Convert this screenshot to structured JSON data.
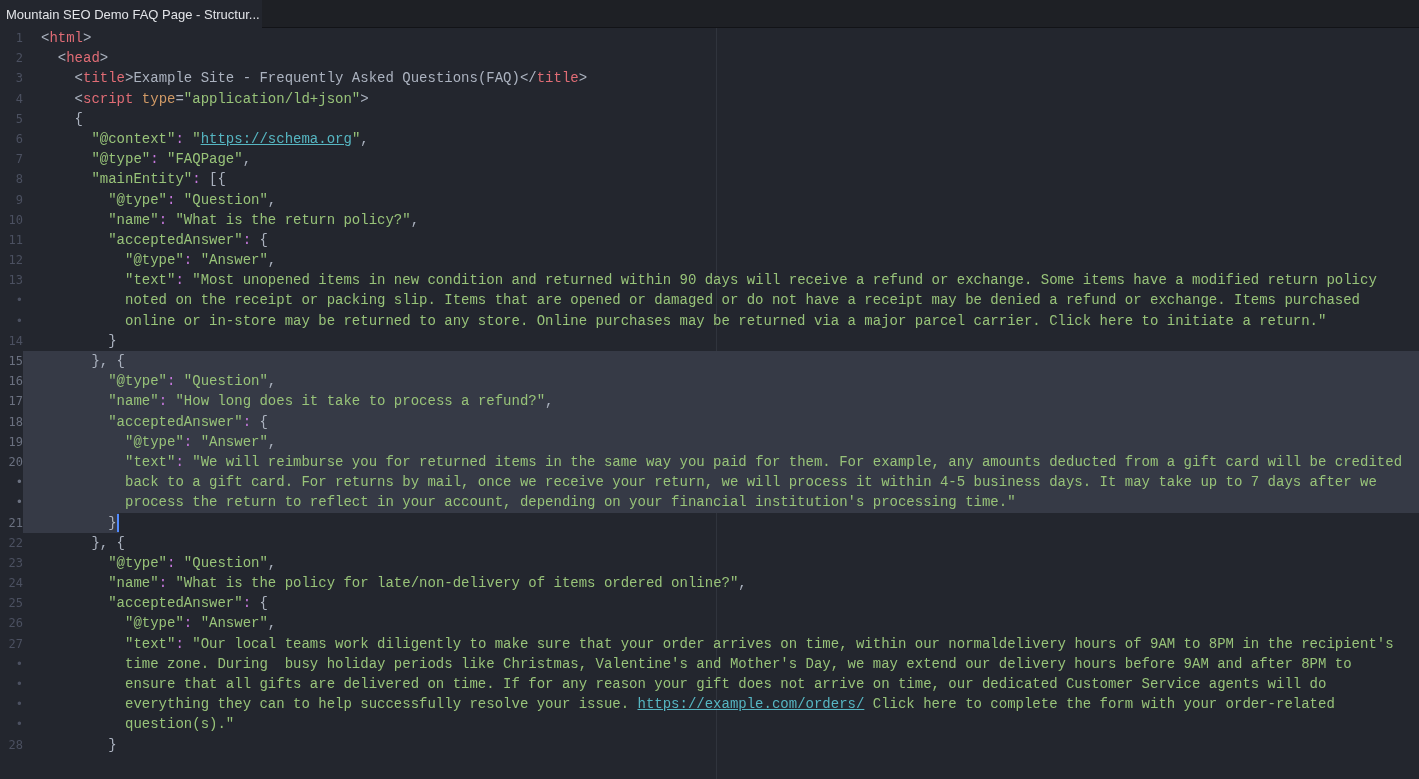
{
  "tab": {
    "title": "Mountain SEO Demo FAQ Page - Structur...",
    "selected": true
  },
  "lines": [
    {
      "gutter": "1",
      "selected": false,
      "cursor": false,
      "tokens": [
        {
          "kind": "punct",
          "text": "<"
        },
        {
          "kind": "tag",
          "text": "html"
        },
        {
          "kind": "punct",
          "text": ">"
        }
      ]
    },
    {
      "gutter": "2",
      "selected": false,
      "cursor": false,
      "tokens": [
        {
          "kind": "punct",
          "text": "  <"
        },
        {
          "kind": "tag",
          "text": "head"
        },
        {
          "kind": "punct",
          "text": ">"
        }
      ]
    },
    {
      "gutter": "3",
      "selected": false,
      "cursor": false,
      "tokens": [
        {
          "kind": "punct",
          "text": "    <"
        },
        {
          "kind": "tag",
          "text": "title"
        },
        {
          "kind": "punct",
          "text": ">"
        },
        {
          "kind": "plain",
          "text": "Example Site - Frequently Asked Questions(FAQ)"
        },
        {
          "kind": "punct",
          "text": "</"
        },
        {
          "kind": "tag",
          "text": "title"
        },
        {
          "kind": "punct",
          "text": ">"
        }
      ]
    },
    {
      "gutter": "4",
      "selected": false,
      "cursor": false,
      "tokens": [
        {
          "kind": "punct",
          "text": "    <"
        },
        {
          "kind": "tag",
          "text": "script "
        },
        {
          "kind": "attr",
          "text": "type"
        },
        {
          "kind": "punct",
          "text": "="
        },
        {
          "kind": "string",
          "text": "\"application/ld+json\""
        },
        {
          "kind": "punct",
          "text": ">"
        }
      ]
    },
    {
      "gutter": "5",
      "selected": false,
      "cursor": false,
      "tokens": [
        {
          "kind": "punct",
          "text": "    {"
        }
      ]
    },
    {
      "gutter": "6",
      "selected": false,
      "cursor": false,
      "tokens": [
        {
          "kind": "string",
          "text": "      \"@context\""
        },
        {
          "kind": "colon",
          "text": ": "
        },
        {
          "kind": "string",
          "text": "\""
        },
        {
          "kind": "link",
          "text": "https://schema.org"
        },
        {
          "kind": "string",
          "text": "\""
        },
        {
          "kind": "punct",
          "text": ","
        }
      ]
    },
    {
      "gutter": "7",
      "selected": false,
      "cursor": false,
      "tokens": [
        {
          "kind": "string",
          "text": "      \"@type\""
        },
        {
          "kind": "colon",
          "text": ": "
        },
        {
          "kind": "string",
          "text": "\"FAQPage\""
        },
        {
          "kind": "punct",
          "text": ","
        }
      ]
    },
    {
      "gutter": "8",
      "selected": false,
      "cursor": false,
      "tokens": [
        {
          "kind": "string",
          "text": "      \"mainEntity\""
        },
        {
          "kind": "colon",
          "text": ": "
        },
        {
          "kind": "punct",
          "text": "[{"
        }
      ]
    },
    {
      "gutter": "9",
      "selected": false,
      "cursor": false,
      "tokens": [
        {
          "kind": "string",
          "text": "        \"@type\""
        },
        {
          "kind": "colon",
          "text": ": "
        },
        {
          "kind": "string",
          "text": "\"Question\""
        },
        {
          "kind": "punct",
          "text": ","
        }
      ]
    },
    {
      "gutter": "10",
      "selected": false,
      "cursor": false,
      "tokens": [
        {
          "kind": "string",
          "text": "        \"name\""
        },
        {
          "kind": "colon",
          "text": ": "
        },
        {
          "kind": "string",
          "text": "\"What is the return policy?\""
        },
        {
          "kind": "punct",
          "text": ","
        }
      ]
    },
    {
      "gutter": "11",
      "selected": false,
      "cursor": false,
      "tokens": [
        {
          "kind": "string",
          "text": "        \"acceptedAnswer\""
        },
        {
          "kind": "colon",
          "text": ": "
        },
        {
          "kind": "punct",
          "text": "{"
        }
      ]
    },
    {
      "gutter": "12",
      "selected": false,
      "cursor": false,
      "tokens": [
        {
          "kind": "string",
          "text": "          \"@type\""
        },
        {
          "kind": "colon",
          "text": ": "
        },
        {
          "kind": "string",
          "text": "\"Answer\""
        },
        {
          "kind": "punct",
          "text": ","
        }
      ]
    },
    {
      "gutter": "13",
      "selected": false,
      "cursor": false,
      "tokens": [
        {
          "kind": "string",
          "text": "          \"text\""
        },
        {
          "kind": "colon",
          "text": ": "
        },
        {
          "kind": "string",
          "text": "\"Most unopened items in new condition and returned within 90 days will receive a refund or exchange. Some items have a modified return policy"
        }
      ]
    },
    {
      "gutter": "•",
      "selected": false,
      "cursor": false,
      "tokens": [
        {
          "kind": "string",
          "text": "          noted on the receipt or packing slip. Items that are opened or damaged or do not have a receipt may be denied a refund or exchange. Items purchased"
        }
      ]
    },
    {
      "gutter": "•",
      "selected": false,
      "cursor": false,
      "tokens": [
        {
          "kind": "string",
          "text": "          online or in-store may be returned to any store. Online purchases may be returned via a major parcel carrier. Click here to initiate a return.\""
        }
      ]
    },
    {
      "gutter": "14",
      "selected": false,
      "cursor": false,
      "tokens": [
        {
          "kind": "punct",
          "text": "        }"
        }
      ]
    },
    {
      "gutter": "15",
      "selected": true,
      "cursor": false,
      "tokens": [
        {
          "kind": "punct",
          "text": "      }, {"
        }
      ]
    },
    {
      "gutter": "16",
      "selected": true,
      "cursor": false,
      "tokens": [
        {
          "kind": "string",
          "text": "        \"@type\""
        },
        {
          "kind": "colon",
          "text": ": "
        },
        {
          "kind": "string",
          "text": "\"Question\""
        },
        {
          "kind": "punct",
          "text": ","
        }
      ]
    },
    {
      "gutter": "17",
      "selected": true,
      "cursor": false,
      "tokens": [
        {
          "kind": "string",
          "text": "        \"name\""
        },
        {
          "kind": "colon",
          "text": ": "
        },
        {
          "kind": "string",
          "text": "\"How long does it take to process a refund?\""
        },
        {
          "kind": "punct",
          "text": ","
        }
      ]
    },
    {
      "gutter": "18",
      "selected": true,
      "cursor": false,
      "tokens": [
        {
          "kind": "string",
          "text": "        \"acceptedAnswer\""
        },
        {
          "kind": "colon",
          "text": ": "
        },
        {
          "kind": "punct",
          "text": "{"
        }
      ]
    },
    {
      "gutter": "19",
      "selected": true,
      "cursor": false,
      "tokens": [
        {
          "kind": "string",
          "text": "          \"@type\""
        },
        {
          "kind": "colon",
          "text": ": "
        },
        {
          "kind": "string",
          "text": "\"Answer\""
        },
        {
          "kind": "punct",
          "text": ","
        }
      ]
    },
    {
      "gutter": "20",
      "selected": true,
      "cursor": false,
      "tokens": [
        {
          "kind": "string",
          "text": "          \"text\""
        },
        {
          "kind": "colon",
          "text": ": "
        },
        {
          "kind": "string",
          "text": "\"We will reimburse you for returned items in the same way you paid for them. For example, any amounts deducted from a gift card will be credited"
        }
      ]
    },
    {
      "gutter": "•",
      "selected": true,
      "cursor": false,
      "tokens": [
        {
          "kind": "string",
          "text": "          back to a gift card. For returns by mail, once we receive your return, we will process it within 4-5 business days. It may take up to 7 days after we"
        }
      ]
    },
    {
      "gutter": "•",
      "selected": true,
      "cursor": false,
      "tokens": [
        {
          "kind": "string",
          "text": "          process the return to reflect in your account, depending on your financial institution's processing time.\""
        }
      ]
    },
    {
      "gutter": "21",
      "selected": true,
      "cursor": true,
      "tokens": [
        {
          "kind": "punct",
          "text": "        }"
        }
      ]
    },
    {
      "gutter": "22",
      "selected": false,
      "cursor": false,
      "tokens": [
        {
          "kind": "punct",
          "text": "      }, {"
        }
      ]
    },
    {
      "gutter": "23",
      "selected": false,
      "cursor": false,
      "tokens": [
        {
          "kind": "string",
          "text": "        \"@type\""
        },
        {
          "kind": "colon",
          "text": ": "
        },
        {
          "kind": "string",
          "text": "\"Question\""
        },
        {
          "kind": "punct",
          "text": ","
        }
      ]
    },
    {
      "gutter": "24",
      "selected": false,
      "cursor": false,
      "tokens": [
        {
          "kind": "string",
          "text": "        \"name\""
        },
        {
          "kind": "colon",
          "text": ": "
        },
        {
          "kind": "string",
          "text": "\"What is the policy for late/non-delivery of items ordered online?\""
        },
        {
          "kind": "punct",
          "text": ","
        }
      ]
    },
    {
      "gutter": "25",
      "selected": false,
      "cursor": false,
      "tokens": [
        {
          "kind": "string",
          "text": "        \"acceptedAnswer\""
        },
        {
          "kind": "colon",
          "text": ": "
        },
        {
          "kind": "punct",
          "text": "{"
        }
      ]
    },
    {
      "gutter": "26",
      "selected": false,
      "cursor": false,
      "tokens": [
        {
          "kind": "string",
          "text": "          \"@type\""
        },
        {
          "kind": "colon",
          "text": ": "
        },
        {
          "kind": "string",
          "text": "\"Answer\""
        },
        {
          "kind": "punct",
          "text": ","
        }
      ]
    },
    {
      "gutter": "27",
      "selected": false,
      "cursor": false,
      "tokens": [
        {
          "kind": "string",
          "text": "          \"text\""
        },
        {
          "kind": "colon",
          "text": ": "
        },
        {
          "kind": "string",
          "text": "\"Our local teams work diligently to make sure that your order arrives on time, within our normaldelivery hours of 9AM to 8PM in the recipient's"
        }
      ]
    },
    {
      "gutter": "•",
      "selected": false,
      "cursor": false,
      "tokens": [
        {
          "kind": "string",
          "text": "          time zone. During  busy holiday periods like Christmas, Valentine's and Mother's Day, we may extend our delivery hours before 9AM and after 8PM to"
        }
      ]
    },
    {
      "gutter": "•",
      "selected": false,
      "cursor": false,
      "tokens": [
        {
          "kind": "string",
          "text": "          ensure that all gifts are delivered on time. If for any reason your gift does not arrive on time, our dedicated Customer Service agents will do"
        }
      ]
    },
    {
      "gutter": "•",
      "selected": false,
      "cursor": false,
      "tokens": [
        {
          "kind": "string",
          "text": "          everything they can to help successfully resolve your issue. "
        },
        {
          "kind": "link",
          "text": "https://example.com/orders/"
        },
        {
          "kind": "string",
          "text": " Click here to complete the form with your order-related"
        }
      ]
    },
    {
      "gutter": "•",
      "selected": false,
      "cursor": false,
      "tokens": [
        {
          "kind": "string",
          "text": "          question(s).\""
        }
      ]
    },
    {
      "gutter": "28",
      "selected": false,
      "cursor": false,
      "tokens": [
        {
          "kind": "punct",
          "text": "        }"
        }
      ]
    }
  ]
}
